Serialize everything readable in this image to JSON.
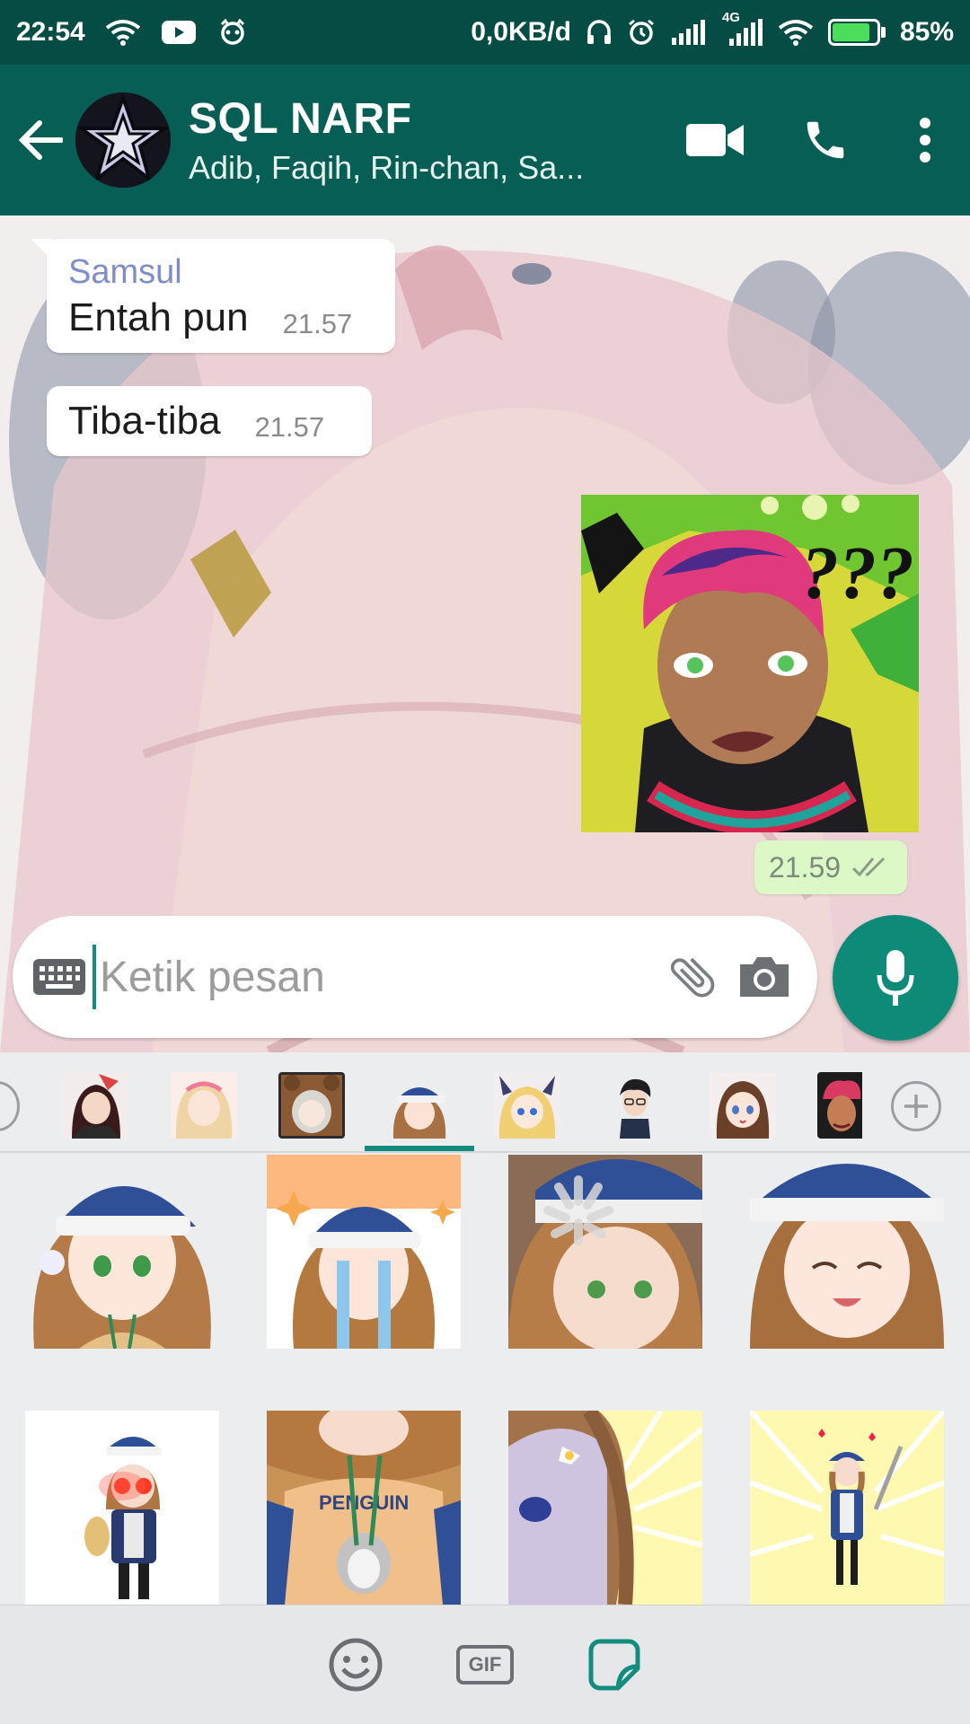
{
  "status_bar": {
    "time": "22:54",
    "data_speed": "0,0KB/d",
    "network_label": "4G",
    "battery_percent": "85%",
    "battery_level": 0.85,
    "icons": [
      "wifi-icon",
      "youtube-icon",
      "app-notification-icon",
      "headset-icon",
      "alarm-icon",
      "signal-icon",
      "4g-signal-icon",
      "wifi-icon",
      "battery-charging-icon"
    ]
  },
  "header": {
    "title": "SQL NARF",
    "subtitle": "Adib, Faqih, Rin-chan, Sa...",
    "actions": [
      "video-call-icon",
      "voice-call-icon",
      "more-options-icon"
    ]
  },
  "messages": [
    {
      "sender": "Samsul",
      "text": "Entah pun",
      "time": "21.57"
    },
    {
      "text": "Tiba-tiba",
      "time": "21.57"
    }
  ],
  "sent_sticker": {
    "caption": "???",
    "time": "21.59",
    "status": "double-tick-icon"
  },
  "composer": {
    "placeholder": "Ketik pesan",
    "value": ""
  },
  "sticker_tray": {
    "packs_count_visible": 8,
    "selected_pack_index": 3,
    "add_icon": "add-pack-icon"
  },
  "bottom_nav": {
    "items": [
      "emoji-icon",
      "gif-icon",
      "sticker-icon"
    ],
    "gif_label": "GIF",
    "selected": "sticker-icon"
  },
  "colors": {
    "header": "#075e54",
    "status_bar": "#054d44",
    "accent": "#128c7e",
    "sent_bubble": "#dcf8c6",
    "sender_name": "#7f8ec9"
  }
}
